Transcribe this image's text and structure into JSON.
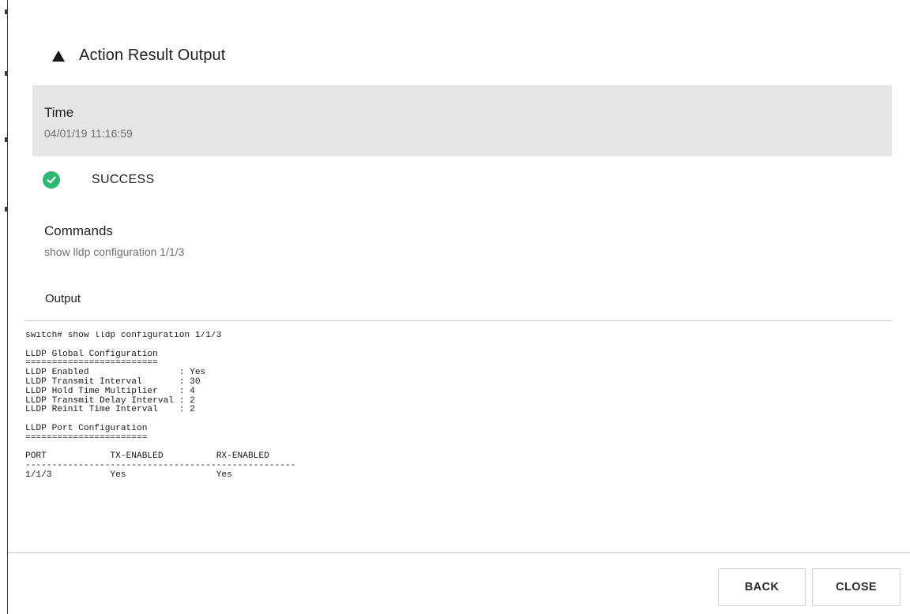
{
  "header": {
    "title": "Action Result Output",
    "icon": "triangle-up-icon"
  },
  "time": {
    "label": "Time",
    "value": "04/01/19 11:16:59"
  },
  "status": {
    "text": "SUCCESS",
    "icon": "check-circle-icon",
    "color": "#2eb872"
  },
  "commands": {
    "label": "Commands",
    "value": "show lldp configuration 1/1/3"
  },
  "output": {
    "label": "Output",
    "text": "switch# show lldp configuration 1/1/3\n\nLLDP Global Configuration\n=========================\nLLDP Enabled                 : Yes\nLLDP Transmit Interval       : 30\nLLDP Hold Time Multiplier    : 4\nLLDP Transmit Delay Interval : 2\nLLDP Reinit Time Interval    : 2\n\nLLDP Port Configuration\n=======================\n\nPORT            TX-ENABLED          RX-ENABLED\n---------------------------------------------------\n1/1/3           Yes                 Yes"
  },
  "footer": {
    "back_label": "BACK",
    "close_label": "CLOSE"
  },
  "colors": {
    "time_panel_bg": "#e6e6e6",
    "success": "#2eb872"
  }
}
